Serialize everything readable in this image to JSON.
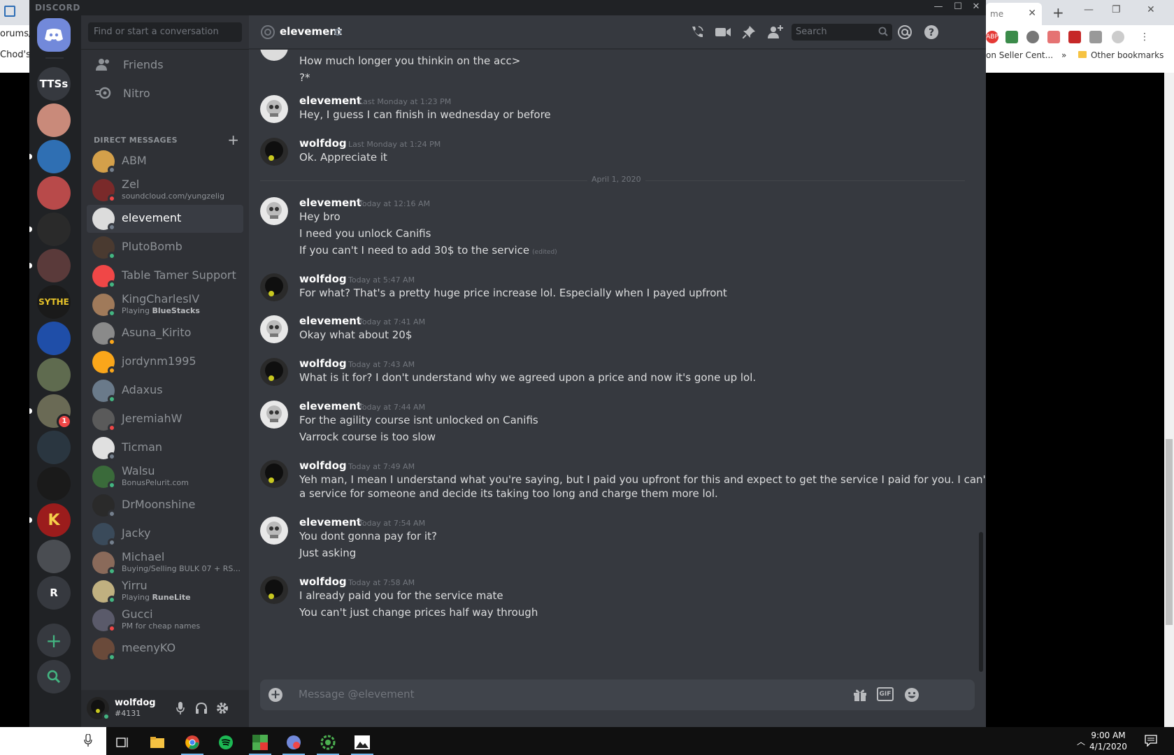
{
  "app": {
    "brand": "DISCORD"
  },
  "browser": {
    "left_tab_text": "orums/",
    "left_bookmark": "Chod's",
    "right_tab_text": "me",
    "bookmarks": [
      "on Seller Cent...",
      "»",
      "Other bookmarks"
    ]
  },
  "guilds": [
    {
      "label": "TTSs",
      "color": "#36393f"
    },
    {
      "label": "",
      "color": "#c98a7a"
    },
    {
      "label": "",
      "color": "#2f6fb3"
    },
    {
      "label": "",
      "color": "#b84a4a"
    },
    {
      "label": "",
      "color": "#2a2a2a"
    },
    {
      "label": "",
      "color": "#5a3a3a"
    },
    {
      "label": "SYTHE",
      "color": "#1a1a1a"
    },
    {
      "label": "",
      "color": "#1f4ea8"
    },
    {
      "label": "",
      "color": "#5f6b4f"
    },
    {
      "label": "1",
      "color": "#6a6a55"
    },
    {
      "label": "",
      "color": "#2a3640"
    },
    {
      "label": "",
      "color": "#1a1a1a"
    },
    {
      "label": "K",
      "color": "#9b1c1c"
    },
    {
      "label": "",
      "color": "#4a4d52"
    },
    {
      "label": "R",
      "color": "#36393f"
    }
  ],
  "sidebar": {
    "search_placeholder": "Find or start a conversation",
    "nav": [
      {
        "label": "Friends"
      },
      {
        "label": "Nitro"
      }
    ],
    "dm_header": "DIRECT MESSAGES",
    "dms": [
      {
        "name": "ABM",
        "status": "#747f8d",
        "av": "#d4a04a"
      },
      {
        "name": "Zel",
        "sub": "soundcloud.com/yungzelig",
        "status": "#f04747",
        "av": "#7a2a2a"
      },
      {
        "name": "elevement",
        "status": "#747f8d",
        "av": "#dcdcdc",
        "active": true
      },
      {
        "name": "PlutoBomb",
        "status": "#43b581",
        "av": "#4a3a30"
      },
      {
        "name": "Table Tamer Support",
        "status": "#43b581",
        "av": "#f04747"
      },
      {
        "name": "KingCharlesIV",
        "sub_prefix": "Playing ",
        "sub_bold": "BlueStacks",
        "status": "#43b581",
        "av": "#a07a5a"
      },
      {
        "name": "Asuna_Kirito",
        "status": "#faa61a",
        "av": "#8a8a8a"
      },
      {
        "name": "jordynm1995",
        "status": "#faa61a",
        "av": "#faa61a"
      },
      {
        "name": "Adaxus",
        "status": "#43b581",
        "av": "#6a7a8a"
      },
      {
        "name": "JeremiahW",
        "status": "#f04747",
        "av": "#5a5a5a"
      },
      {
        "name": "Ticman",
        "status": "#747f8d",
        "av": "#e0e0e0"
      },
      {
        "name": "Walsu",
        "sub": "BonusPelurit.com",
        "status": "#43b581",
        "av": "#3a6a3a"
      },
      {
        "name": "DrMoonshine",
        "status": "#747f8d",
        "av": "#2a2a2a"
      },
      {
        "name": "Jacky",
        "status": "#747f8d",
        "av": "#3a4a5a"
      },
      {
        "name": "Michael",
        "sub": "Buying/Selling BULK 07 + RS...",
        "status": "#43b581",
        "av": "#8a6a5a"
      },
      {
        "name": "Yirru",
        "sub_prefix": "Playing ",
        "sub_bold": "RuneLite",
        "status": "#43b581",
        "av": "#c0b080"
      },
      {
        "name": "Gucci",
        "sub": "PM for cheap names",
        "status": "#f04747",
        "av": "#5a5a6a"
      },
      {
        "name": "meenyKO",
        "status": "#43b581",
        "av": "#6a4a3a"
      }
    ]
  },
  "user": {
    "name": "wolfdog",
    "tag": "#4131"
  },
  "chat": {
    "channel": "elevement",
    "search_placeholder": "Search",
    "composer_placeholder": "Message @elevement",
    "gif_label": "GIF",
    "date_divider": "April 1, 2020",
    "edited_label": "(edited)",
    "top_lines": [
      "How much longer you thinkin on the acc>",
      "?*"
    ],
    "groups": [
      {
        "author": "elevement",
        "time": "Last Monday at 1:23 PM",
        "lines": [
          "Hey, I guess I can finish in wednesday or before"
        ]
      },
      {
        "author": "wolfdog",
        "time": "Last Monday at 1:24 PM",
        "lines": [
          "Ok. Appreciate it"
        ]
      },
      {
        "author": "elevement",
        "time": "Today at 12:16 AM",
        "lines": [
          "Hey bro",
          "I need you unlock Canifis",
          "If you can't I need to add 30$ to the service"
        ]
      },
      {
        "author": "wolfdog",
        "time": "Today at 5:47 AM",
        "lines": [
          "For what? That's a pretty huge price increase lol. Especially when I payed upfront"
        ]
      },
      {
        "author": "elevement",
        "time": "Today at 7:41 AM",
        "lines": [
          "Okay what about 20$"
        ]
      },
      {
        "author": "wolfdog",
        "time": "Today at 7:43 AM",
        "lines": [
          "What is it for? I don't understand why we agreed upon a price and now it's gone up lol."
        ]
      },
      {
        "author": "elevement",
        "time": "Today at 7:44 AM",
        "lines": [
          "For the agility course isnt unlocked on Canifis",
          "Varrock course is too slow"
        ]
      },
      {
        "author": "wolfdog",
        "time": "Today at 7:49 AM",
        "lines": [
          "Yeh man, I mean I understand what you're saying, but I paid you upfront for this and expect to get the service I paid for you. I can't just do",
          "a service for someone and decide its taking too long and charge them more lol."
        ]
      },
      {
        "author": "elevement",
        "time": "Today at 7:54 AM",
        "lines": [
          "You dont gonna pay for it?",
          "Just asking"
        ]
      },
      {
        "author": "wolfdog",
        "time": "Today at 7:58 AM",
        "lines": [
          "I already paid you for the service mate",
          "You can't just change prices half way through"
        ]
      }
    ]
  },
  "taskbar": {
    "time": "9:00 AM",
    "date": "4/1/2020"
  },
  "colors": {
    "blurple": "#7289da",
    "online": "#43b581",
    "dnd": "#f04747",
    "idle": "#faa61a",
    "offline": "#747f8d"
  }
}
